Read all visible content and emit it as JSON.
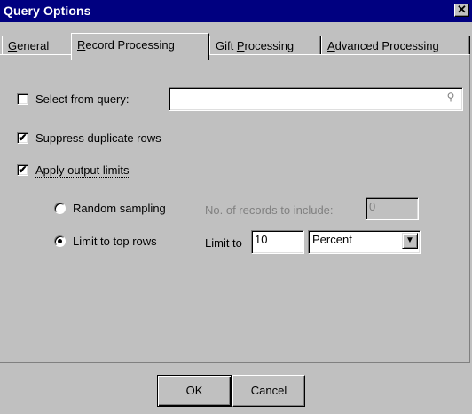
{
  "window": {
    "title": "Query Options",
    "close_icon": "close-icon",
    "close_glyph": "✕"
  },
  "tabs": [
    {
      "pre": "",
      "accel": "G",
      "post": "eneral",
      "active": false
    },
    {
      "pre": "",
      "accel": "R",
      "post": "ecord Processing",
      "active": true
    },
    {
      "pre": "Gift ",
      "accel": "P",
      "post": "rocessing",
      "active": false
    },
    {
      "pre": "",
      "accel": "A",
      "post": "dvanced Processing",
      "active": false
    }
  ],
  "record_processing": {
    "select_from_query": {
      "label": "Select from query:",
      "checked": false,
      "value": "",
      "browse_icon": "binoculars-icon",
      "browse_glyph": "⚲"
    },
    "suppress_duplicates": {
      "label": "Suppress duplicate rows",
      "checked": true
    },
    "apply_output_limits": {
      "label": "Apply output limits",
      "checked": true
    },
    "random_sampling": {
      "label": "Random sampling",
      "selected": false
    },
    "records_to_include": {
      "label": "No. of records to include:",
      "value": "0"
    },
    "limit_to_top_rows": {
      "label": "Limit to top rows",
      "selected": true
    },
    "limit_to": {
      "label": "Limit to",
      "value": "10"
    },
    "limit_unit": {
      "selected": "Percent",
      "arrow_icon": "dropdown-arrow-icon",
      "arrow_glyph": "▼"
    },
    "check_glyph": "✔"
  },
  "buttons": {
    "ok": "OK",
    "cancel": "Cancel"
  }
}
